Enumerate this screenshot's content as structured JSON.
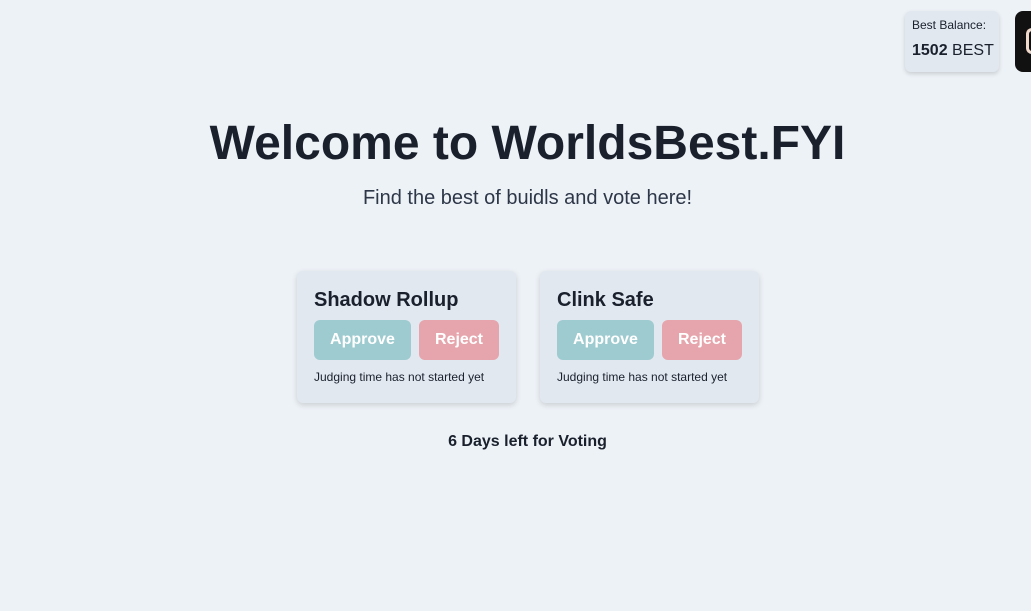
{
  "balance": {
    "label": "Best Balance:",
    "amount": "1502",
    "unit": "BEST"
  },
  "hero": {
    "title": "Welcome to WorldsBest.FYI",
    "subtitle": "Find the best of buidls and vote here!"
  },
  "projects": [
    {
      "name": "Shadow Rollup",
      "approve_label": "Approve",
      "reject_label": "Reject",
      "status": "Judging time has not started yet"
    },
    {
      "name": "Clink Safe",
      "approve_label": "Approve",
      "reject_label": "Reject",
      "status": "Judging time has not started yet"
    }
  ],
  "voting": {
    "days_left_text": "6 Days left for Voting"
  },
  "colors": {
    "background": "#edf2f7",
    "card": "#e2e8f0",
    "approve": "#9ecbd0",
    "reject": "#e6a5ac",
    "wallet": "#111111"
  },
  "icons": {
    "wallet_button": "wallet-icon"
  }
}
